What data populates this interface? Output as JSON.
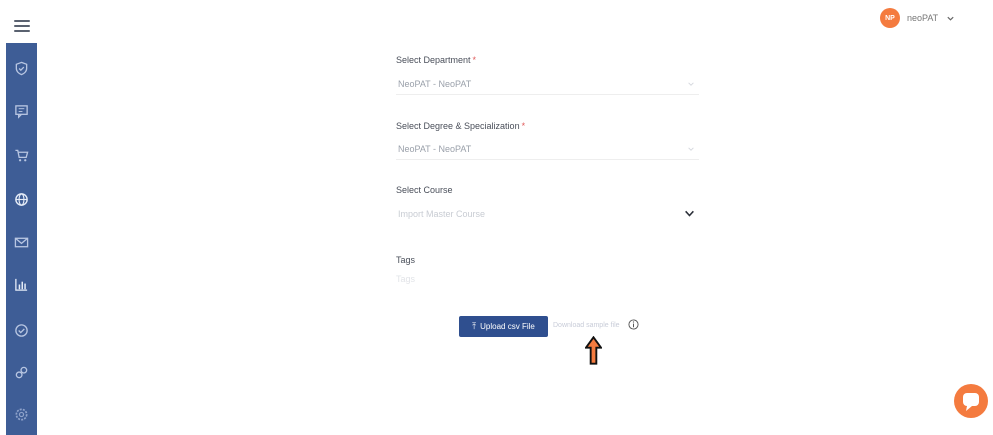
{
  "header": {
    "menu_icon": "hamburger-icon",
    "user": {
      "avatar_initials": "NP",
      "name": "neoPAT",
      "avatar_color": "#f47b3f"
    }
  },
  "sidebar": {
    "color": "#3e5d96",
    "items": [
      {
        "icon": "shield-icon"
      },
      {
        "icon": "message-icon"
      },
      {
        "icon": "cart-icon"
      },
      {
        "icon": "globe-icon"
      },
      {
        "icon": "mail-icon"
      },
      {
        "icon": "bar-chart-icon"
      },
      {
        "icon": "check-circle-icon"
      },
      {
        "icon": "link-icon"
      },
      {
        "icon": "settings-icon"
      }
    ]
  },
  "form": {
    "department": {
      "label": "Select Department",
      "required_mark": "*",
      "value": "NeoPAT - NeoPAT"
    },
    "degree": {
      "label": "Select Degree & Specialization",
      "required_mark": "*",
      "value": "NeoPAT - NeoPAT"
    },
    "course": {
      "label": "Select Course",
      "placeholder": "Import Master Course"
    },
    "tags": {
      "label": "Tags",
      "placeholder": "Tags"
    },
    "upload_button_label": "Upload csv File",
    "sample_link": "Download sample file",
    "accent_color": "#2f4f8f"
  },
  "annotation": {
    "arrow_color": "#f47b3f"
  },
  "chat": {
    "icon": "chat-bubble-icon",
    "color": "#f47b3f"
  }
}
